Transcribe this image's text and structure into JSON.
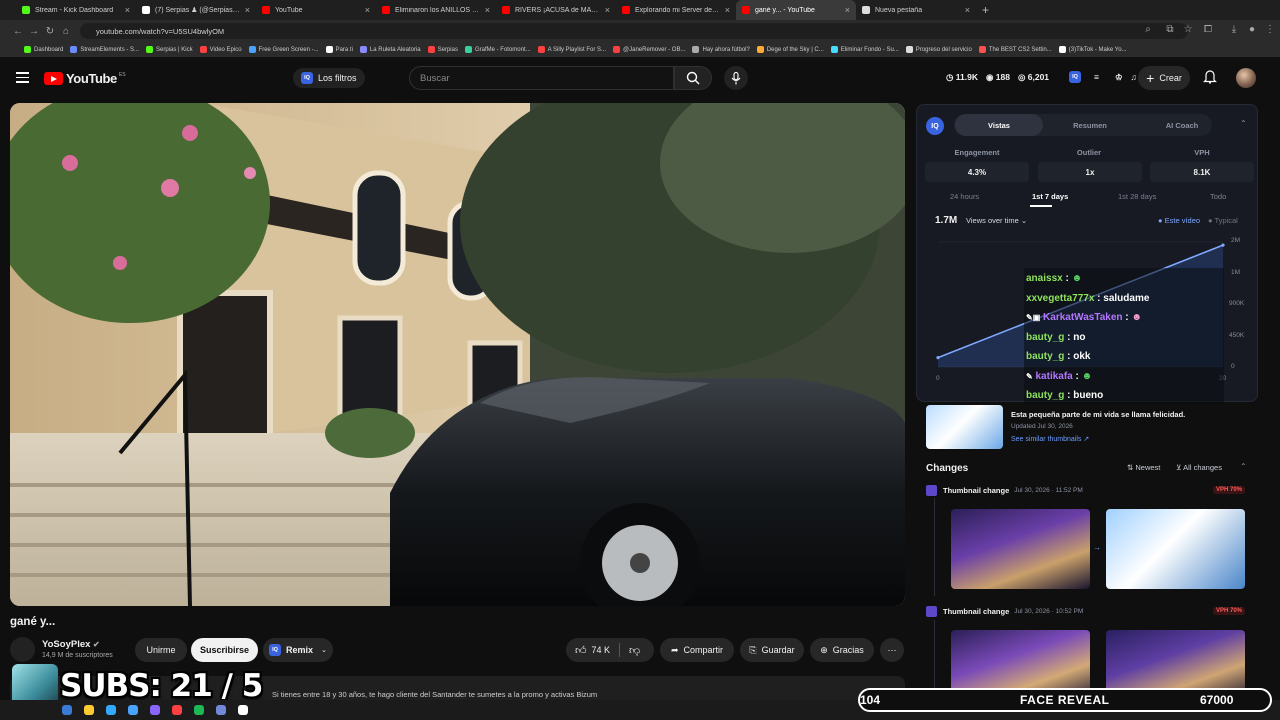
{
  "browser": {
    "tabs": [
      {
        "title": "Stream - Kick Dashboard",
        "color": "#53fc18"
      },
      {
        "title": "(7) Serpias ♟ (@Serpias) / X",
        "color": "#ffffff"
      },
      {
        "title": "YouTube",
        "color": "#ff0000"
      },
      {
        "title": "Eliminaron los ANILLOS DEL EN",
        "color": "#ff0000"
      },
      {
        "title": "RIVERS ¡ACUSA de MANIPULAI",
        "color": "#ff0000"
      },
      {
        "title": "Explorando mi Server de Minec",
        "color": "#ff0000"
      },
      {
        "title": "gané y... - YouTube",
        "color": "#ff0000",
        "active": true
      },
      {
        "title": "Nueva pestaña",
        "color": "#dddddd"
      }
    ],
    "url": "youtube.com/watch?v=U5SU4bwlyOM",
    "bookmarks": [
      "Dashboard",
      "StreamElements - S...",
      "Serpias | Kick",
      "Video Epico",
      "Free Green Screen -...",
      "Para ti",
      "La Ruleta Aleatoria",
      "Serpias",
      "GrafMe - Fotomont...",
      "A Silly Playlist For S...",
      "@JaneRemover - OB...",
      "Hay ahora fútbol?",
      "Dege of the Sky | C...",
      "Eliminar Fondo - Su...",
      "Progreso del servicio",
      "The BEST CS2 Settin...",
      "(3)TikTok - Make Yo..."
    ]
  },
  "header": {
    "logo": "YouTube",
    "country": "ES",
    "filters_label": "Los filtros",
    "search_placeholder": "Buscar",
    "stats": {
      "views": "11.9K",
      "comments": "188",
      "watching": "6,201"
    },
    "create_label": "Crear"
  },
  "video": {
    "title": "gané y...",
    "channel": "YoSoyPlex",
    "subscribers": "14,9 M de suscriptores",
    "join_label": "Unirme",
    "subscribe_label": "Suscribirse",
    "remix_label": "Remix",
    "likes": "74 K",
    "share_label": "Compartir",
    "save_label": "Guardar",
    "thanks_label": "Gracias",
    "description": "Si tienes entre 18 y 30 años, te hago cliente del Santander te sumetes a la promo y activas Bizum"
  },
  "panel": {
    "iq": "IQ",
    "tabs": [
      "Vistas",
      "Resumen",
      "AI Coach"
    ],
    "metrics": [
      {
        "label": "Engagement",
        "value": "4.3%"
      },
      {
        "label": "Outlier",
        "value": "1x"
      },
      {
        "label": "VPH",
        "value": "8.1K"
      }
    ],
    "ranges": [
      "24 hours",
      "1st 7 days",
      "1st 28 days",
      "Todo"
    ],
    "total": "1.7M",
    "metric_select": "Views over time",
    "legend": {
      "este": "Este vídeo",
      "typical": "Typical"
    },
    "y_ticks": [
      "2M",
      "1M",
      "900K",
      "450K",
      "0"
    ],
    "x_ticks": [
      "0",
      "20"
    ]
  },
  "chart_data": {
    "type": "line",
    "series": [
      {
        "name": "Este vídeo",
        "x": [
          0,
          20
        ],
        "y": [
          150000,
          1950000
        ]
      }
    ],
    "ylim": [
      0,
      2000000
    ],
    "xlim": [
      0,
      20
    ]
  },
  "chat": [
    {
      "user": "anaissx",
      "msg": "",
      "color": "green"
    },
    {
      "user": "xxvegetta777x",
      "msg": "saludame",
      "color": "green"
    },
    {
      "user": "KarkatWasTaken",
      "msg": "",
      "color": "purple"
    },
    {
      "user": "bauty_g",
      "msg": "no",
      "color": "green"
    },
    {
      "user": "bauty_g",
      "msg": "okk",
      "color": "green"
    },
    {
      "user": "katikafa",
      "msg": "",
      "color": "purple"
    },
    {
      "user": "bauty_g",
      "msg": "bueno",
      "color": "green"
    }
  ],
  "thumb_info": {
    "title": "Esta pequeña parte de mi vida se llama felicidad.",
    "updated": "Updated Jul 30, 2026",
    "similar": "See similar thumbnails"
  },
  "changes": {
    "title": "Changes",
    "sort": "Newest",
    "filter": "All changes",
    "items": [
      {
        "type": "Thumbnail change",
        "date": "Jul 30, 2026 · 11:52 PM",
        "badge": "VPH 70%"
      },
      {
        "type": "Thumbnail change",
        "date": "Jul 30, 2026 · 10:52 PM",
        "badge": "VPH 70%"
      }
    ]
  },
  "overlay": {
    "subs_label": "SUBS: 21 / 5",
    "count_left": "104",
    "goal_label": "FACE REVEAL",
    "count_right": "67000"
  }
}
